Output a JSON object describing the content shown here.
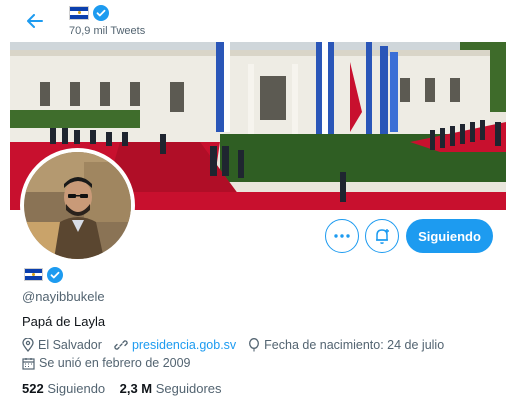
{
  "header": {
    "tweet_count": "70,9 mil Tweets"
  },
  "profile": {
    "handle": "@nayibbukele",
    "bio": "Papá de Layla",
    "location": "El Salvador",
    "website": "presidencia.gob.sv",
    "birthday": "Fecha de nacimiento: 24 de julio",
    "joined": "Se unió en febrero de 2009",
    "following_count": "522",
    "following_label": "Siguiendo",
    "followers_count": "2,3 M",
    "followers_label": "Seguidores"
  },
  "actions": {
    "follow_label": "Siguiendo",
    "more_icon": "more-icon",
    "notify_icon": "notification-bell-icon"
  },
  "colors": {
    "accent": "#1d9bf0",
    "flag_blue": "#0b3fae",
    "carpet_red": "#c8102e"
  }
}
